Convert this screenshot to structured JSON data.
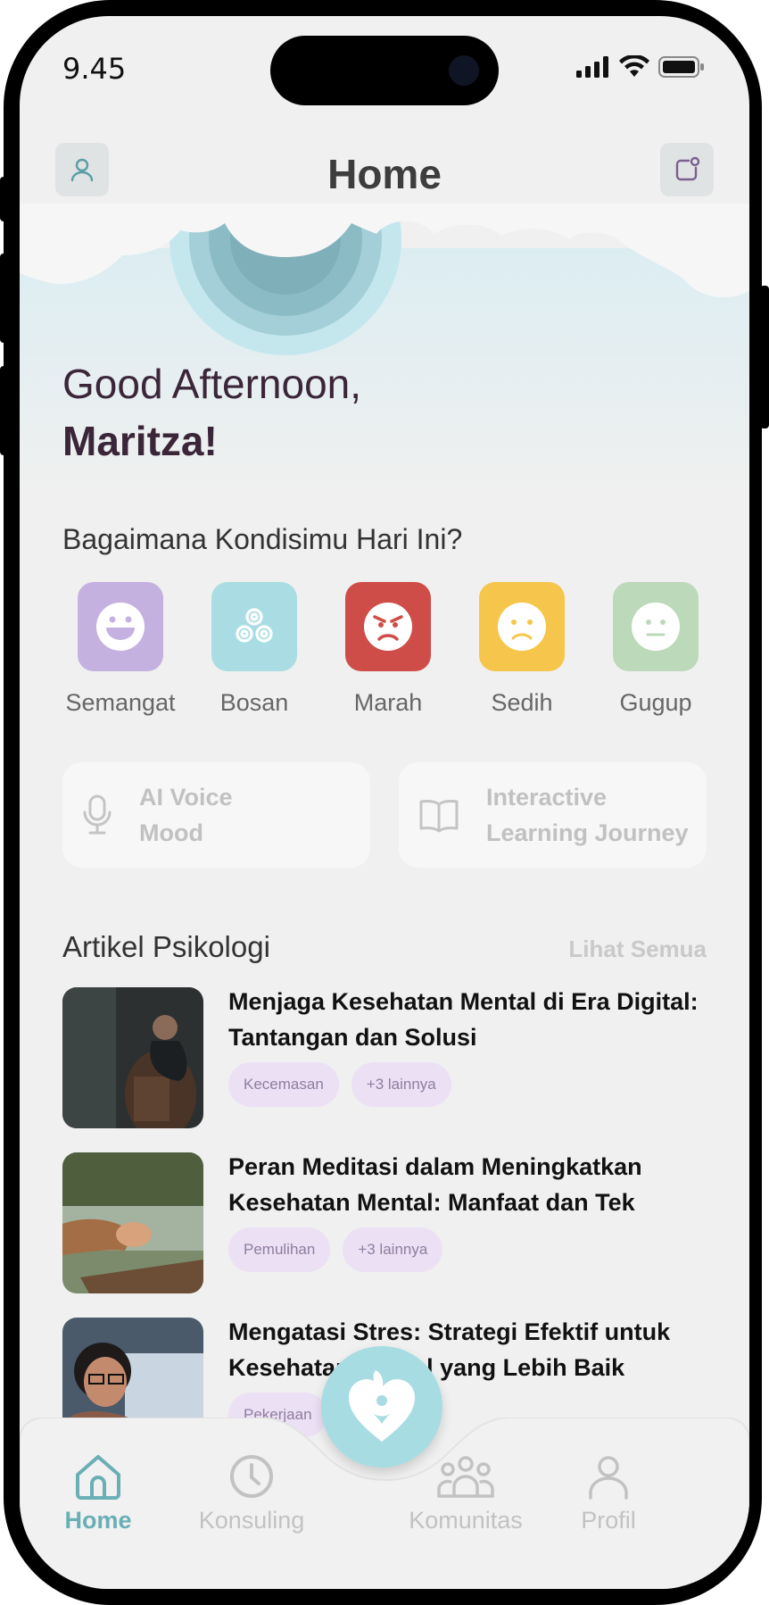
{
  "status_bar": {
    "time": "9.45"
  },
  "header": {
    "title": "Home"
  },
  "greeting": {
    "line1": "Good Afternoon,",
    "name": "Maritza!"
  },
  "mood": {
    "question": "Bagaimana Kondisimu Hari Ini?",
    "options": [
      {
        "label": "Semangat",
        "color": "#c4b1e0",
        "icon": "grin-face-icon"
      },
      {
        "label": "Bosan",
        "color": "#a9dde3",
        "icon": "triskelion-icon"
      },
      {
        "label": "Marah",
        "color": "#cf4d49",
        "icon": "angry-face-icon"
      },
      {
        "label": "Sedih",
        "color": "#f6c54c",
        "icon": "sad-face-icon"
      },
      {
        "label": "Gugup",
        "color": "#bcd9ba",
        "icon": "neutral-face-icon"
      }
    ]
  },
  "features": [
    {
      "label": "AI Voice\nMood",
      "icon": "microphone-icon"
    },
    {
      "label": "Interactive\nLearning Journey",
      "icon": "book-icon"
    }
  ],
  "articles_section": {
    "title": "Artikel Psikologi",
    "see_all": "Lihat Semua"
  },
  "articles": [
    {
      "title": "Menjaga Kesehatan Mental di Era Digital: Tantangan dan Solusi",
      "tags": [
        "Kecemasan",
        "+3 lainnya"
      ]
    },
    {
      "title": "Peran Meditasi dalam Meningkatkan Kesehatan Mental: Manfaat dan Tek",
      "tags": [
        "Pemulihan",
        "+3 lainnya"
      ]
    },
    {
      "title": "Mengatasi Stres: Strategi Efektif untuk Kesehatan Mental yang Lebih Baik",
      "tags": [
        "Pekerjaan"
      ]
    }
  ],
  "bottom_nav": {
    "items": [
      {
        "label": "Home",
        "icon": "home-icon",
        "active": true
      },
      {
        "label": "Konsuling",
        "icon": "clock-icon",
        "active": false
      },
      {
        "label": "Komunitas",
        "icon": "community-icon",
        "active": false
      },
      {
        "label": "Profil",
        "icon": "person-icon",
        "active": false
      }
    ],
    "center_icon": "heart-leaf-logo-icon"
  },
  "colors": {
    "accent": "#6aaeb6",
    "text_dark": "#3b2538",
    "tag_bg": "#ece0f5"
  }
}
